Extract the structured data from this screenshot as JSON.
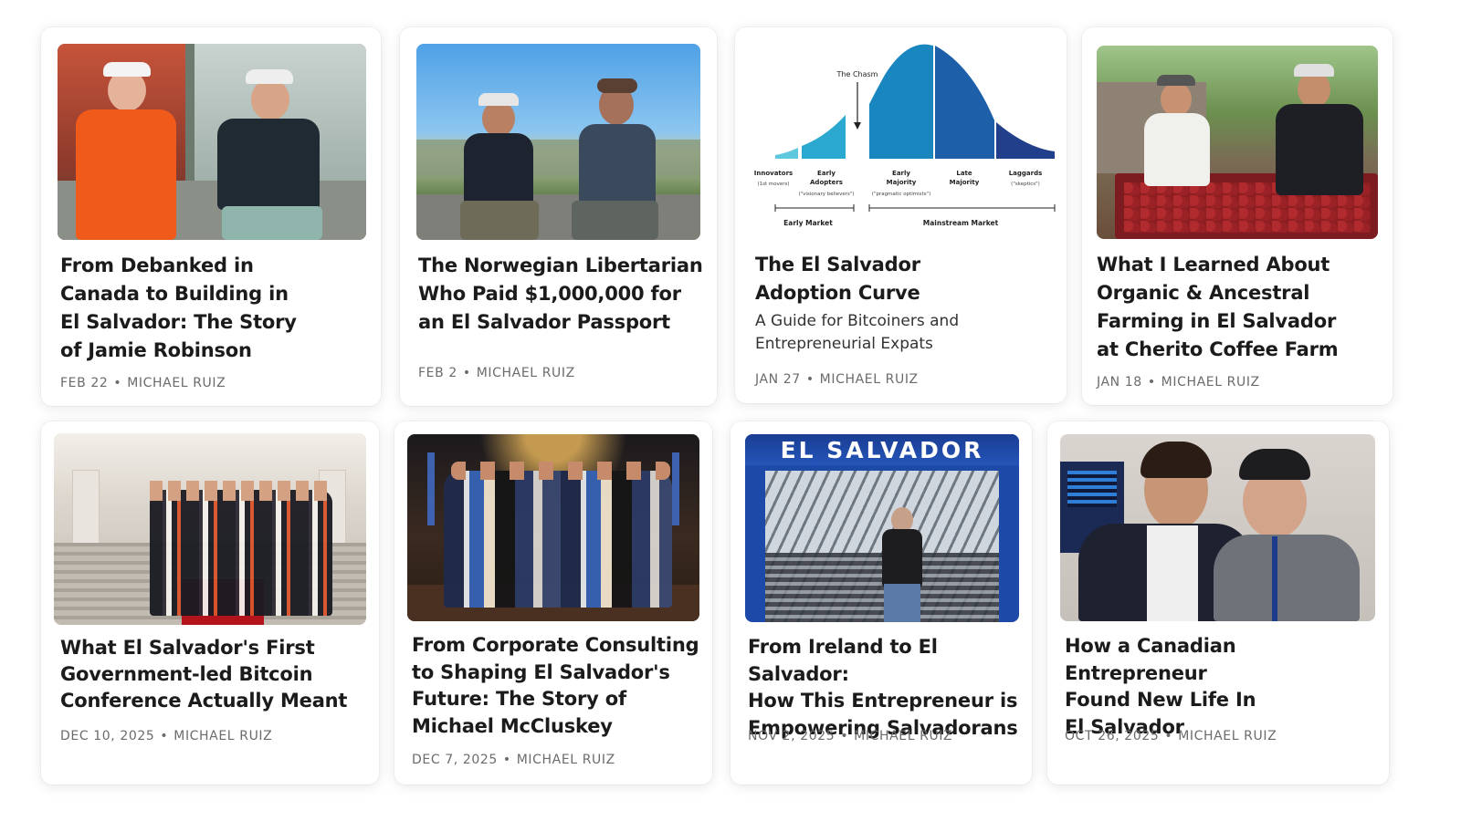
{
  "cards": [
    {
      "title": "From Debanked in\nCanada to Building in\nEl Salvador: The Story\nof Jamie Robinson",
      "date": "FEB 22",
      "author": "MICHAEL RUIZ",
      "image": "two-men-speaking-on-stage-photo"
    },
    {
      "title": "The Norwegian Libertarian\nWho Paid $1,000,000 for\nan El Salvador Passport",
      "date": "FEB 2",
      "author": "MICHAEL RUIZ",
      "image": "two-men-sitting-on-mountain-wall-photo"
    },
    {
      "title": "The El Salvador\nAdoption Curve",
      "subtitle": "A Guide for Bitcoiners and\nEntrepreneurial Expats",
      "date": "JAN 27",
      "author": "MICHAEL RUIZ",
      "image": "adoption-curve-diagram",
      "diagram": {
        "chasm_label": "The Chasm",
        "segments": [
          {
            "label": "Innovators",
            "note": "(1st movers)",
            "color": "#5ec8dc"
          },
          {
            "label": "Early\nAdopters",
            "note": "(\"visionary believers\")",
            "color": "#2aa8d0"
          },
          {
            "label": "Early\nMajority",
            "note": "(\"pragmatic optimists\")",
            "color": "#1a86c0"
          },
          {
            "label": "Late\nMajority",
            "note": "",
            "color": "#1d5fa8"
          },
          {
            "label": "Laggards",
            "note": "(\"skeptics\")",
            "color": "#213f8a"
          }
        ],
        "markets": [
          "Early Market",
          "Mainstream Market"
        ]
      }
    },
    {
      "title": "What I Learned About\nOrganic & Ancestral\nFarming in El Salvador\nat Cherito Coffee Farm",
      "date": "JAN 18",
      "author": "MICHAEL RUIZ",
      "image": "men-at-coffee-drying-bed-photo"
    },
    {
      "title": "What El Salvador's First\nGovernment-led Bitcoin\nConference Actually Meant",
      "date": "DEC 10, 2025",
      "author": "MICHAEL RUIZ",
      "image": "group-photo-on-palace-stairs"
    },
    {
      "title": "From Corporate Consulting\nto Shaping El Salvador's\nFuture: The Story of\nMichael McCluskey",
      "date": "DEC 7, 2025",
      "author": "MICHAEL RUIZ",
      "image": "group-photo-with-flags"
    },
    {
      "title": "From Ireland to El Salvador:\nHow This Entrepreneur is\nEmpowering Salvadorans",
      "date": "NOV 2, 2025",
      "author": "MICHAEL RUIZ",
      "image": "man-at-el-salvador-arrival-sign",
      "sign_text": "EL SALVADOR"
    },
    {
      "title": "How a Canadian Entrepreneur\nFound New Life In\nEl Salvador",
      "date": "OCT 26, 2025",
      "author": "MICHAEL RUIZ",
      "image": "two-men-airport-selfie"
    }
  ],
  "separator": "•"
}
